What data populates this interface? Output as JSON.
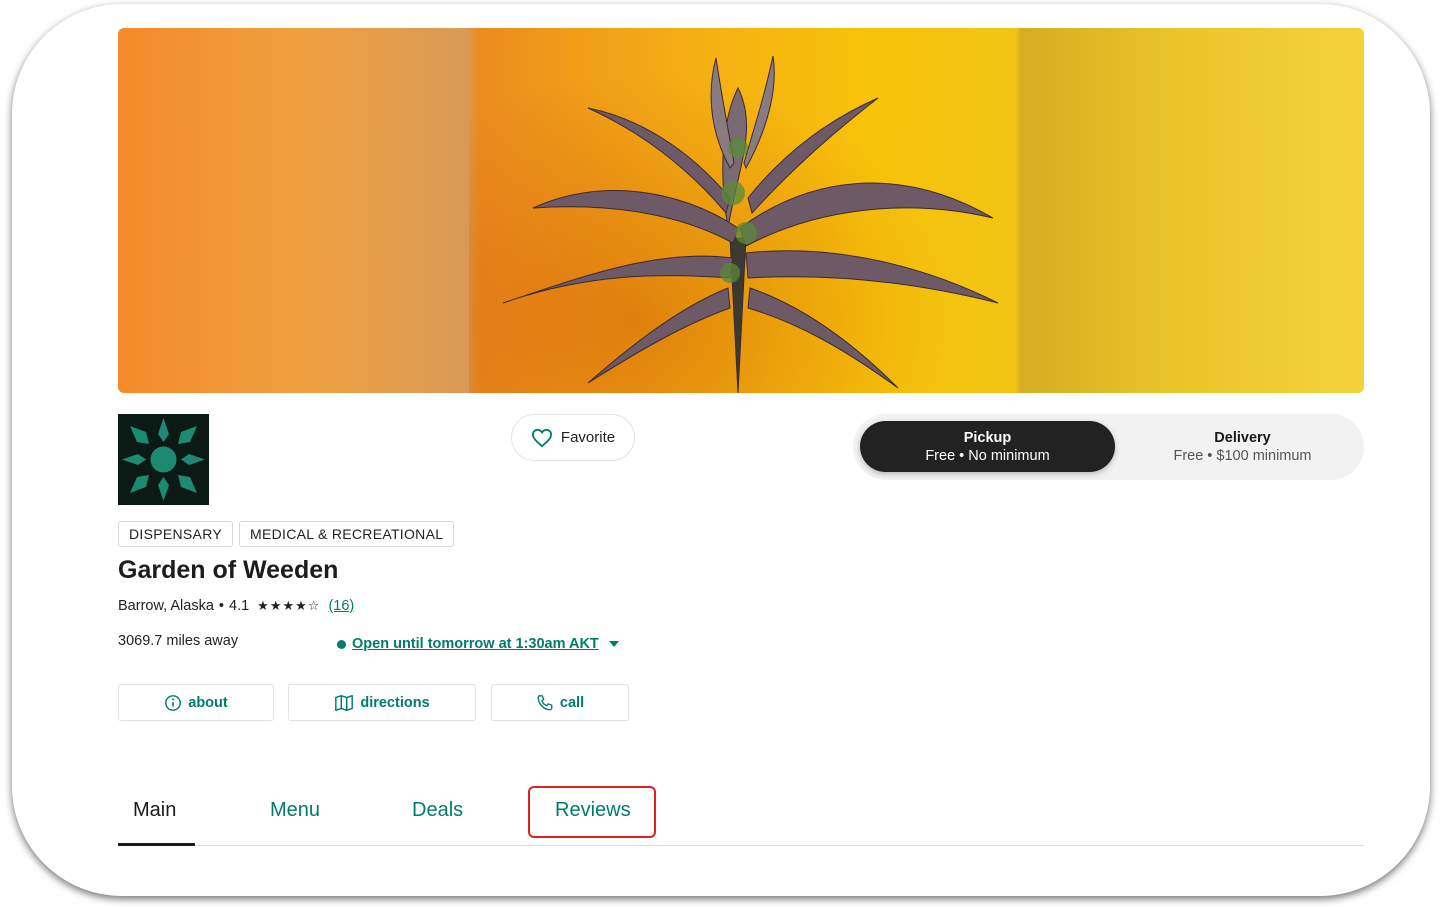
{
  "hero": {
    "alt": "cannabis-flower-banner"
  },
  "favorite": {
    "label": "Favorite",
    "icon": "heart-icon"
  },
  "order_mode": {
    "pickup": {
      "title": "Pickup",
      "subtitle": "Free • No minimum",
      "selected": true
    },
    "delivery": {
      "title": "Delivery",
      "subtitle": "Free • $100 minimum",
      "selected": false
    }
  },
  "tags": [
    "DISPENSARY",
    "MEDICAL & RECREATIONAL"
  ],
  "store": {
    "name": "Garden of Weeden",
    "location": "Barrow, Alaska",
    "separator": "•",
    "rating": "4.1",
    "rating_value": 4.1,
    "stars_out_of": 5,
    "review_count": "(16)",
    "distance": "3069.7 miles away",
    "hours": "Open until tomorrow at 1:30am AKT"
  },
  "actions": {
    "about": "about",
    "directions": "directions",
    "call": "call"
  },
  "tabs": {
    "main": "Main",
    "menu": "Menu",
    "deals": "Deals",
    "reviews": "Reviews"
  },
  "colors": {
    "accent": "#017c6b",
    "dark": "#222222",
    "highlight": "#e0201c"
  }
}
